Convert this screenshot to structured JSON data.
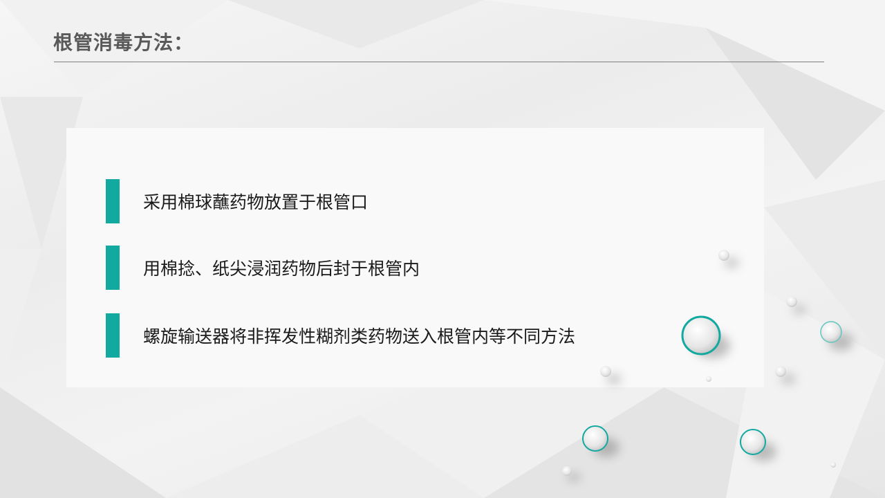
{
  "slide": {
    "title": "根管消毒方法：",
    "items": [
      {
        "label": "采用棉球蘸药物放置于根管口"
      },
      {
        "label": "用棉捻、纸尖浸润药物后封于根管内"
      },
      {
        "label": "螺旋输送器将非挥发性糊剂类药物送入根管内等不同方法"
      }
    ]
  },
  "colors": {
    "accent": "#12a9a0",
    "title_text": "#595959",
    "body_text": "#1a1a1a",
    "card_bg": "#f9f9f9",
    "rule": "#7f7f7f"
  }
}
